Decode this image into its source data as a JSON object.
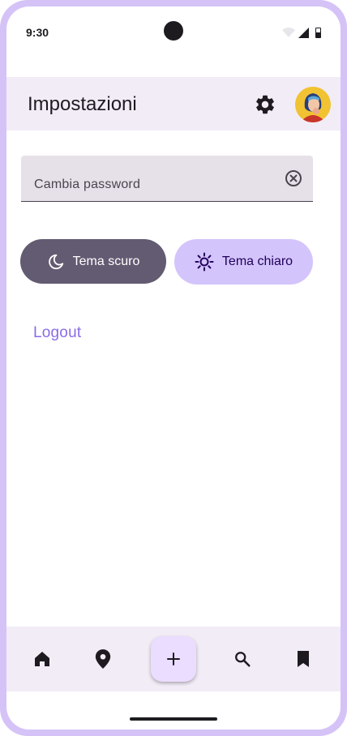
{
  "status_bar": {
    "time": "9:30"
  },
  "app_bar": {
    "title": "Impostazioni",
    "settings_icon": "gear-icon",
    "avatar_icon": "avatar"
  },
  "password_field": {
    "label": "Cambia password",
    "clear_icon": "clear-icon"
  },
  "theme_buttons": {
    "dark_label": "Tema scuro",
    "dark_icon": "moon-icon",
    "light_label": "Tema chiaro",
    "light_icon": "sun-icon"
  },
  "logout_label": "Logout",
  "bottom_nav": {
    "items": [
      {
        "icon": "home-icon"
      },
      {
        "icon": "location-pin-icon"
      },
      {
        "icon": "plus-icon"
      },
      {
        "icon": "search-icon"
      },
      {
        "icon": "bookmark-icon"
      }
    ]
  },
  "colors": {
    "frame": "#d5c3f7",
    "app_bar_bg": "#f2ecf7",
    "dark_button": "#635b72",
    "light_button": "#d3c4fb",
    "logout_text": "#8a6be8",
    "fab_bg": "#ebddff"
  }
}
